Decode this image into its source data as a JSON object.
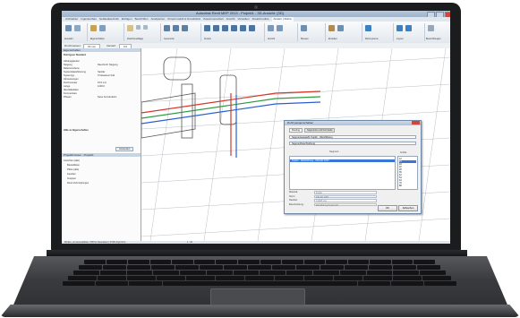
{
  "app": {
    "title": "Autodesk Revit MEP 2013 - Projekt1 - 3D-Ansicht: {3D}",
    "ribbon_tabs": [
      "Architektur",
      "Ingenieurbau",
      "Gebäudetechnik",
      "Einfügen",
      "Beschriften",
      "Analysieren",
      "Körpermodell & Grundstück",
      "Zusammenarbeit",
      "Ansicht",
      "Verwalten",
      "Zusatzmodule",
      "Ändern | Rohre"
    ],
    "active_tab": "Ändern | Rohre",
    "ribbon_groups": [
      "Auswahl",
      "Eigenschaften",
      "Zwischenablage",
      "Geometrie",
      "Ändern",
      "Ansicht",
      "Messen",
      "Erstellen",
      "Rohrsysteme",
      "Layout",
      "Beschriftungen"
    ],
    "option_bar": {
      "label1": "Durchmesser:",
      "value1": "15 mm",
      "label2": "Versatz:",
      "value2": "0.0"
    }
  },
  "properties": {
    "header": "Eigenschaften",
    "type_name": "Rohrtypen Standard",
    "rows": [
      {
        "label": "Abhängigkeiten",
        "value": ""
      },
      {
        "label": "Neigung",
        "value": "Rauchrohr Neigung"
      },
      {
        "label": "Referenzebene",
        "value": ""
      },
      {
        "label": "Systemklassifizierung",
        "value": "Sanitär"
      },
      {
        "label": "Systemtyp",
        "value": "Trinkwasser Kalt"
      },
      {
        "label": "Abmessungen",
        "value": ""
      },
      {
        "label": "Durchmesser",
        "value": "15.0 mm"
      },
      {
        "label": "Länge",
        "value": "1200.0"
      },
      {
        "label": "Identitätsdaten",
        "value": ""
      },
      {
        "label": "Kommentare",
        "value": ""
      },
      {
        "label": "Phasen",
        "value": "Neue Konstruktion"
      }
    ],
    "help_title": "Hilfe zu Eigenschaften",
    "help_text": "Anwenden",
    "browser_header": "Projektbrowser - Projekt1",
    "browser_items": [
      "Ansichten (alle)",
      "Bauteillisten",
      "Pläne (alle)",
      "Familien",
      "Gruppen",
      "Revit-Verknüpfungen"
    ]
  },
  "dialog": {
    "title": "Rohrtypeigenschaften",
    "tabs": [
      "Routing",
      "Segmente und Formteile"
    ],
    "selects": [
      "Segmentauswahl: Kupfer - Weichlötung",
      "Segmentbeschreibung"
    ],
    "list_header": "Segment",
    "list_selected": "Kupfer - Weichlötung - DIN EN 1057",
    "sizes_header": "Größe",
    "sizes": [
      "12",
      "15",
      "18",
      "22",
      "28",
      "35",
      "42",
      "54",
      "64",
      "76",
      "88"
    ],
    "fields": [
      {
        "label": "Material:",
        "value": "Kupfer"
      },
      {
        "label": "Norm:",
        "value": "DIN EN 1057"
      },
      {
        "label": "Rauheit:",
        "value": "0.0015 mm"
      },
      {
        "label": "Beschreibung:",
        "value": "Weichlötung Kupferrohr"
      }
    ],
    "buttons": {
      "ok": "OK",
      "cancel": "Abbrechen"
    }
  },
  "status": {
    "text": "Klicken, um auszuwählen; TAB für Alternativen; STRG fügt hinzu",
    "zoom": "1 : 20"
  },
  "colors": {
    "accent": "#3875d7",
    "pipe_red": "#d23a2a",
    "pipe_green": "#2e9b3f",
    "pipe_blue": "#2a5ed2",
    "bezel": "#1b1c1e"
  }
}
